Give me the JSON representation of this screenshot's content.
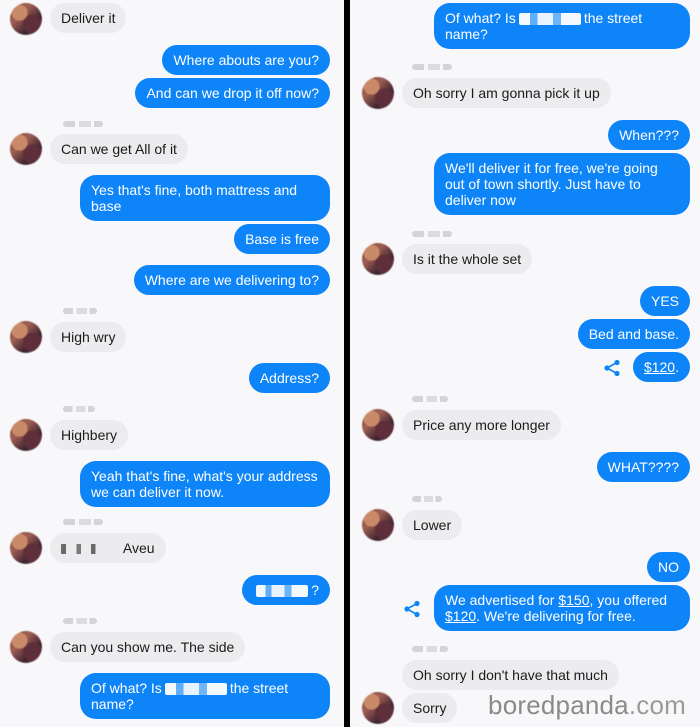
{
  "left": {
    "m1": "Deliver it",
    "m2": "Where abouts are you?",
    "m3": "And can we drop it off now?",
    "m4": "Can we get All of it",
    "m5": "Yes that's fine, both mattress and base",
    "m6": "Base is free",
    "m7": "Where are we delivering to?",
    "m8": "High wry",
    "m9": "Address?",
    "m10": "Highbery",
    "m11": "Yeah that's fine, what's your address we can deliver it now.",
    "m12_suffix": "Aveu",
    "m13_suffix": "?",
    "m14": "Can you show me. The  side",
    "m15_pre": "Of what? Is",
    "m15_post": "the street name?"
  },
  "right": {
    "m1_pre": "Of what? Is",
    "m1_post": "the street name?",
    "m2": "Oh sorry I am gonna pick it up",
    "m3": "When???",
    "m4": "We'll deliver it for free, we're going out of town shortly. Just have to deliver now",
    "m5": "Is it the whole set",
    "m6": "YES",
    "m7": "Bed and base.",
    "m8_link": "$120",
    "m8_post": ".",
    "m9": "Price any more longer",
    "m10": "WHAT????",
    "m11": "Lower",
    "m12": "NO",
    "m13_a": "We advertised for ",
    "m13_link1": "$150",
    "m13_b": ", you offered ",
    "m13_link2": "$120",
    "m13_c": ". We're delivering for free.",
    "m14": "Oh sorry I don't have that much",
    "m15": "Sorry"
  },
  "icons": {
    "share": "share-icon",
    "avatar": "blurred-avatar"
  },
  "watermark": {
    "brand": "boredpanda",
    "tld": ".com"
  },
  "colors": {
    "outgoing_bubble": "#0d84f7",
    "incoming_bubble": "#ececef",
    "background": "#f8f8fa"
  }
}
